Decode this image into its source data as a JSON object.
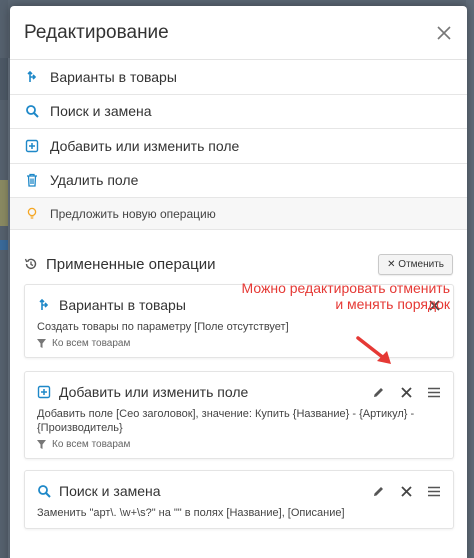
{
  "modal": {
    "title": "Редактирование",
    "operations": [
      {
        "label": "Варианты в товары",
        "icon": "variants-icon"
      },
      {
        "label": "Поиск и замена",
        "icon": "search-icon"
      },
      {
        "label": "Добавить или изменить поле",
        "icon": "plus-square-icon"
      },
      {
        "label": "Удалить поле",
        "icon": "trash-icon"
      }
    ],
    "suggest": {
      "label": "Предложить новую операцию",
      "icon": "lightbulb-icon"
    }
  },
  "applied": {
    "title": "Примененные операции",
    "cancel_label": "✕ Отменить",
    "cards": [
      {
        "title": "Варианты в товары",
        "icon": "variants-icon",
        "description": "Создать товары по параметру [Поле отсутствует]",
        "filter": "Ко всем товарам",
        "actions": [
          "close"
        ]
      },
      {
        "title": "Добавить или изменить поле",
        "icon": "plus-square-icon",
        "description": "Добавить поле [Сео заголовок], значение: Купить {Название} - {Артикул} - {Производитель}",
        "filter": "Ко всем товарам",
        "actions": [
          "edit",
          "close",
          "menu"
        ]
      },
      {
        "title": "Поиск и замена",
        "icon": "search-icon",
        "description": "Заменить \"арт\\. \\w+\\s?\" на \"\" в полях [Название], [Описание]",
        "filter": "",
        "actions": [
          "edit",
          "close",
          "menu"
        ]
      }
    ]
  },
  "annotation": {
    "text": "Можно редактировать отменить и менять порядок",
    "color": "#e53935"
  },
  "colors": {
    "accent": "#1e88c8",
    "icon_gray": "#555555",
    "bulb": "#f5a623"
  }
}
